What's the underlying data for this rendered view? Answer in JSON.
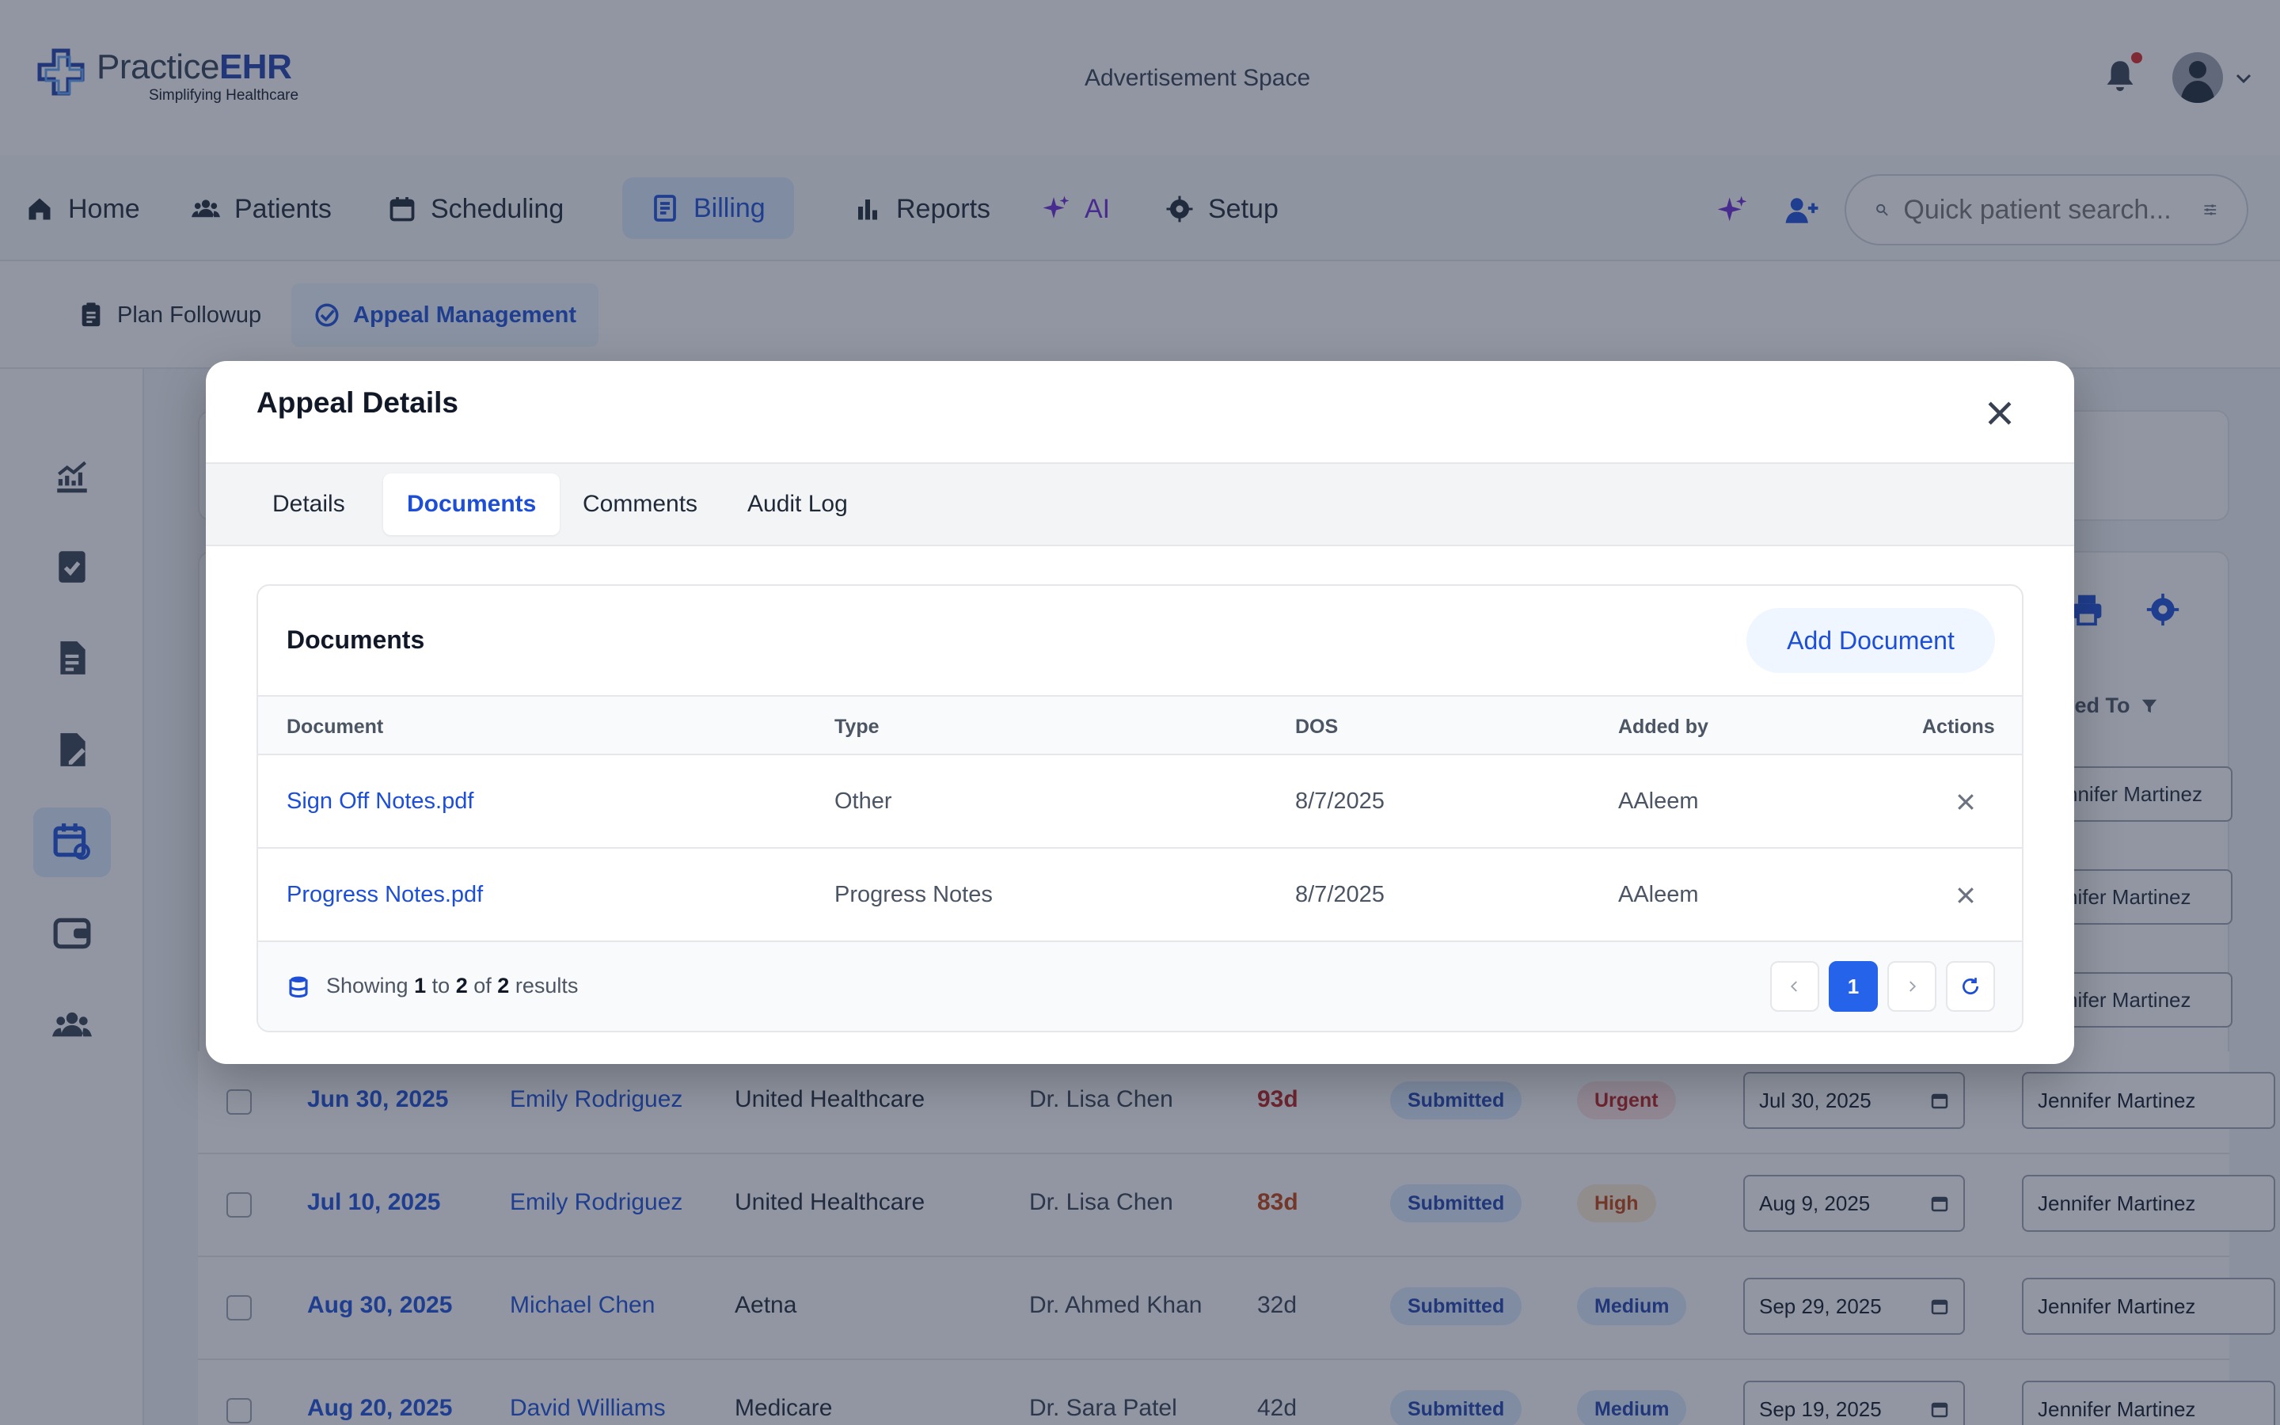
{
  "brand": {
    "name_prefix": "Practice",
    "name_suffix": "EHR",
    "tagline": "Simplifying Healthcare"
  },
  "header": {
    "ad_space": "Advertisement Space"
  },
  "nav": {
    "items": [
      {
        "label": "Home",
        "icon": "home-icon"
      },
      {
        "label": "Patients",
        "icon": "users-icon"
      },
      {
        "label": "Scheduling",
        "icon": "calendar-icon"
      },
      {
        "label": "Billing",
        "icon": "billing-icon",
        "active": true
      },
      {
        "label": "Reports",
        "icon": "bar-chart-icon"
      },
      {
        "label": "AI",
        "icon": "sparkles-icon"
      },
      {
        "label": "Setup",
        "icon": "gear-icon"
      }
    ],
    "search_placeholder": "Quick patient search..."
  },
  "subnav": {
    "items": [
      {
        "label": "Plan Followup",
        "icon": "clipboard-icon"
      },
      {
        "label": "Appeal Management",
        "icon": "check-circle-icon",
        "active": true
      }
    ]
  },
  "background_table": {
    "header_assigned": "ned To",
    "partial_assignees": [
      "nnifer Martinez",
      "nifer Martinez",
      "nifer Martinez"
    ],
    "rows": [
      {
        "date": "Jun 30, 2025",
        "patient": "Emily Rodriguez",
        "payer": "United Healthcare",
        "provider": "Dr. Lisa Chen",
        "age": "93d",
        "status": "Submitted",
        "priority": "Urgent",
        "due": "Jul 30, 2025",
        "assigned": "Jennifer Martinez"
      },
      {
        "date": "Jul 10, 2025",
        "patient": "Emily Rodriguez",
        "payer": "United Healthcare",
        "provider": "Dr. Lisa Chen",
        "age": "83d",
        "status": "Submitted",
        "priority": "High",
        "due": "Aug 9, 2025",
        "assigned": "Jennifer Martinez"
      },
      {
        "date": "Aug 30, 2025",
        "patient": "Michael Chen",
        "payer": "Aetna",
        "provider": "Dr. Ahmed Khan",
        "age": "32d",
        "status": "Submitted",
        "priority": "Medium",
        "due": "Sep 29, 2025",
        "assigned": "Jennifer Martinez"
      },
      {
        "date": "Aug 20, 2025",
        "patient": "David Williams",
        "payer": "Medicare",
        "provider": "Dr. Sara Patel",
        "age": "42d",
        "status": "Submitted",
        "priority": "Medium",
        "due": "Sep 19, 2025",
        "assigned": "Jennifer Martinez"
      }
    ]
  },
  "modal": {
    "title": "Appeal Details",
    "tabs": [
      {
        "label": "Details"
      },
      {
        "label": "Documents",
        "active": true
      },
      {
        "label": "Comments"
      },
      {
        "label": "Audit Log"
      }
    ],
    "documents": {
      "title": "Documents",
      "add_button": "Add Document",
      "columns": {
        "document": "Document",
        "type": "Type",
        "dos": "DOS",
        "added_by": "Added by",
        "actions": "Actions"
      },
      "rows": [
        {
          "document": "Sign Off Notes.pdf",
          "type": "Other",
          "dos": "8/7/2025",
          "added_by": "AAleem"
        },
        {
          "document": "Progress Notes.pdf",
          "type": "Progress Notes",
          "dos": "8/7/2025",
          "added_by": "AAleem"
        }
      ],
      "footer": {
        "showing": "Showing",
        "from": "1",
        "to_word": "to",
        "to": "2",
        "of_word": "of",
        "total": "2",
        "results": "results"
      },
      "pagination": {
        "current_page": "1"
      }
    }
  },
  "colors": {
    "accent": "#1d4ed8",
    "primary_button": "#2563eb",
    "overlay": "#232d46"
  }
}
